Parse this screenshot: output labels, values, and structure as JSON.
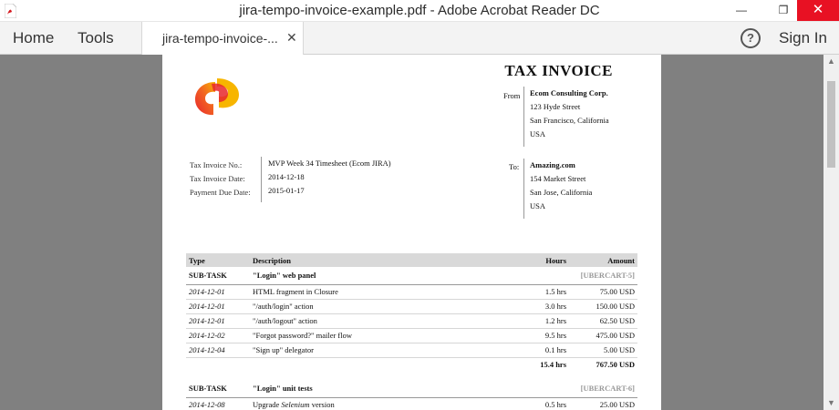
{
  "window": {
    "title": "jira-tempo-invoice-example.pdf - Adobe Acrobat Reader DC"
  },
  "toolbar": {
    "home": "Home",
    "tools": "Tools",
    "tab_label": "jira-tempo-invoice-...",
    "tab_close": "✕",
    "help": "?",
    "sign_in": "Sign In"
  },
  "invoice": {
    "title": "TAX INVOICE",
    "from_label": "From",
    "from": {
      "name": "Ecom Consulting Corp.",
      "street": "123 Hyde Street",
      "city": "San Francisco, California",
      "country": "USA"
    },
    "to_label": "To:",
    "to": {
      "name": "Amazing.com",
      "street": "154 Market Street",
      "city": "San Jose, California",
      "country": "USA"
    },
    "meta": {
      "no_label": "Tax Invoice No.:",
      "no_value": "MVP Week 34 Timesheet (Ecom JIRA)",
      "date_label": "Tax Invoice Date:",
      "date_value": "2014-12-18",
      "due_label": "Payment Due Date:",
      "due_value": "2015-01-17"
    },
    "table": {
      "headers": {
        "type": "Type",
        "description": "Description",
        "hours": "Hours",
        "amount": "Amount"
      },
      "groups": [
        {
          "type": "SUB-TASK",
          "description": "\"Login\" web panel",
          "ref": "[UBERCART-5]",
          "rows": [
            {
              "date": "2014-12-01",
              "description": "HTML fragment in Closure",
              "hours": "1.5 hrs",
              "amount": "75.00 USD"
            },
            {
              "date": "2014-12-01",
              "description": "\"/auth/login\" action",
              "hours": "3.0 hrs",
              "amount": "150.00 USD"
            },
            {
              "date": "2014-12-01",
              "description": "\"/auth/logout\" action",
              "hours": "1.2 hrs",
              "amount": "62.50 USD"
            },
            {
              "date": "2014-12-02",
              "description": "\"Forgot password?\" mailer flow",
              "hours": "9.5 hrs",
              "amount": "475.00 USD"
            },
            {
              "date": "2014-12-04",
              "description": "\"Sign up\" delegator",
              "hours": "0.1 hrs",
              "amount": "5.00 USD"
            }
          ],
          "total_hours": "15.4 hrs",
          "total_amount": "767.50 USD"
        },
        {
          "type": "SUB-TASK",
          "description": "\"Login\" unit tests",
          "ref": "[UBERCART-6]",
          "rows": [
            {
              "date": "2014-12-08",
              "description_prefix": "Upgrade ",
              "description_em": "Selenium",
              "description_suffix": " version",
              "hours": "0.5 hrs",
              "amount": "25.00 USD"
            }
          ]
        }
      ]
    }
  },
  "colors": {
    "close_button": "#e81123",
    "viewer_background": "#808080",
    "logo_red": "#e8262c",
    "logo_yellow": "#f7b500"
  }
}
